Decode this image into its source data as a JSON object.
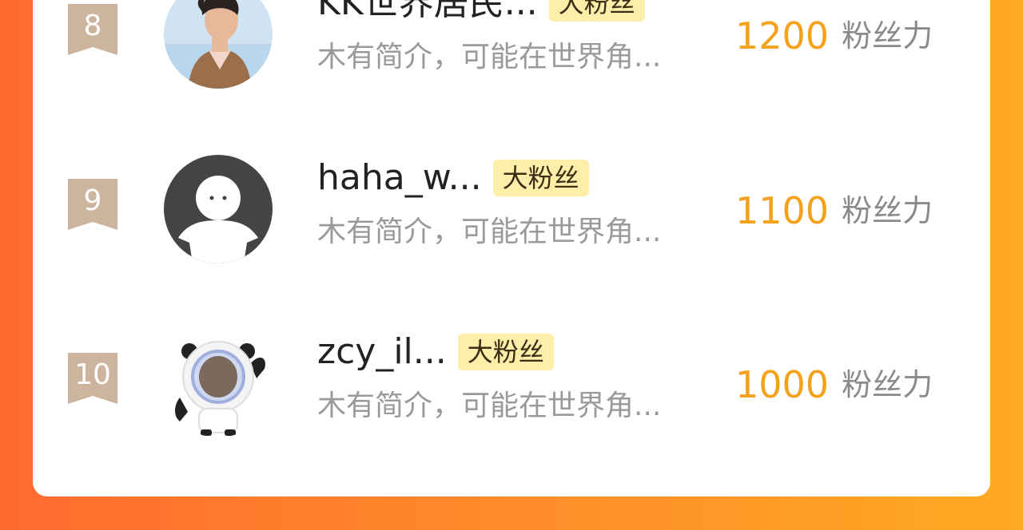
{
  "ranking": {
    "items": [
      {
        "rank": "8",
        "name": "KK世界居民...",
        "tag": "大粉丝",
        "desc": "木有简介，可能在世界角...",
        "score": "1200",
        "score_unit": "粉丝力",
        "avatar": "person-photo"
      },
      {
        "rank": "9",
        "name": "haha_w...",
        "tag": "大粉丝",
        "desc": "木有简介，可能在世界角...",
        "score": "1100",
        "score_unit": "粉丝力",
        "avatar": "default-user-avatar"
      },
      {
        "rank": "10",
        "name": "zcy_il...",
        "tag": "大粉丝",
        "desc": "木有简介，可能在世界角...",
        "score": "1000",
        "score_unit": "粉丝力",
        "avatar": "panda-mascot"
      }
    ]
  },
  "colors": {
    "background_gradient_start": "#ff6a2e",
    "background_gradient_end": "#ffaa22",
    "score": "#f4a21b",
    "tag_bg": "#fdeeaa",
    "rank_badge": "#cdb49f"
  }
}
